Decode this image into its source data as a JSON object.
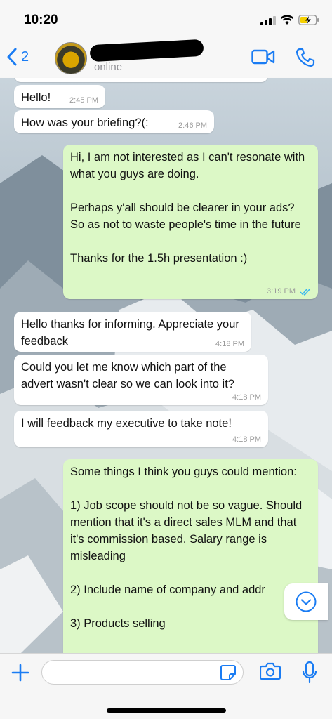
{
  "status_bar": {
    "time": "10:20"
  },
  "header": {
    "back_count": "2",
    "contact_status": "online"
  },
  "messages": [
    {
      "direction": "in",
      "text": "Hello!",
      "time": "2:45 PM"
    },
    {
      "direction": "in",
      "text": "How was your briefing?(:",
      "time": "2:46 PM"
    },
    {
      "direction": "out",
      "paragraphs": [
        "Hi, I am not interested as I can't resonate with what you guys are doing.",
        "Perhaps y'all should be clearer in your ads? So as not to waste people's time in the future",
        "Thanks for the 1.5h presentation :)"
      ],
      "time": "3:19 PM",
      "status": "read"
    },
    {
      "direction": "in",
      "text": "Hello thanks for informing. Appreciate your feedback",
      "time": "4:18 PM"
    },
    {
      "direction": "in",
      "text": "Could you let me know which part of the advert wasn't clear so we can look into it?",
      "time": "4:18 PM"
    },
    {
      "direction": "in",
      "text": "I will feedback my executive to take note!",
      "time": "4:18 PM"
    },
    {
      "direction": "out",
      "paragraphs": [
        "Some things I think you guys could mention:",
        "1) Job scope should not be so vague. Should mention that it's a direct sales MLM and that it's commission based. Salary range is misleading",
        "2) Include name of company and addr",
        "3) Products selling"
      ]
    }
  ],
  "composer": {
    "placeholder": ""
  },
  "colors": {
    "accent": "#1a7cf3",
    "outgoing_bubble": "#dcf8c6",
    "incoming_bubble": "#ffffff",
    "read_ticks": "#34b7f1"
  },
  "icons": [
    "cellular-signal-icon",
    "wifi-icon",
    "battery-charging-icon",
    "chevron-left-icon",
    "video-camera-icon",
    "phone-icon",
    "chevron-down-icon",
    "plus-icon",
    "sticker-icon",
    "camera-icon",
    "microphone-icon"
  ]
}
